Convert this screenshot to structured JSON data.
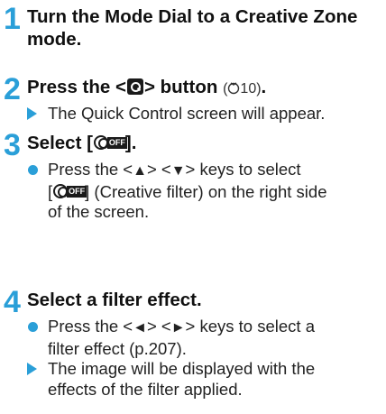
{
  "steps": [
    {
      "number": "1",
      "title": "Turn the Mode Dial to a Creative Zone mode."
    },
    {
      "number": "2",
      "title_pre": "Press the <",
      "title_post": "> button",
      "title_ref_num": "10",
      "title_end": ".",
      "items": [
        {
          "type": "result",
          "text": "The Quick Control screen will appear."
        }
      ]
    },
    {
      "number": "3",
      "title_pre": "Select [",
      "title_post": "].",
      "icon_off_text": "OFF",
      "items": [
        {
          "type": "action",
          "text_a": "Press the <",
          "key1": "▲",
          "text_b": "> <",
          "key2": "▼",
          "text_c": "> keys to select",
          "text_d": "[",
          "text_e": "] (Creative filter) on the right side",
          "text_f": "of the screen."
        }
      ]
    },
    {
      "number": "4",
      "title": "Select a filter effect.",
      "items": [
        {
          "type": "action",
          "text_a": "Press the <",
          "key1": "◄",
          "text_b": "> <",
          "key2": "►",
          "text_c": "> keys to select a",
          "text_d": "filter effect (p.207)."
        },
        {
          "type": "result",
          "line1": "The image will be displayed with the",
          "line2": "effects of the filter applied."
        }
      ]
    }
  ],
  "colors": {
    "accent": "#2a9fd8",
    "text": "#1a1a1a"
  }
}
